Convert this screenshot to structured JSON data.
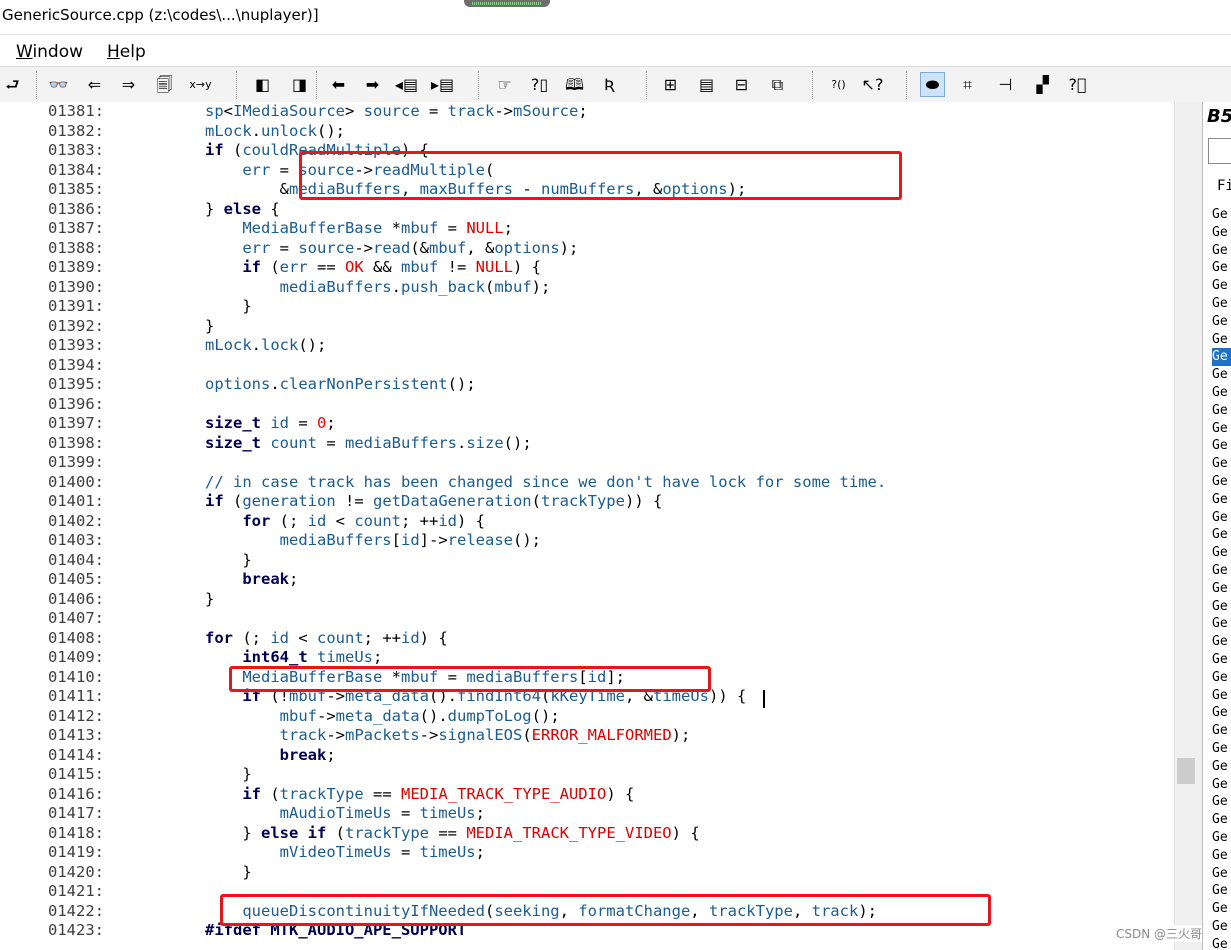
{
  "window": {
    "title": "GenericSource.cpp (z:\\codes\\...\\nuplayer)]"
  },
  "menu": [
    {
      "prefix": "",
      "underline": "W",
      "rest": "indow"
    },
    {
      "prefix": "",
      "underline": "H",
      "rest": "elp"
    }
  ],
  "toolbar": {
    "buttons": [
      {
        "icon": "lookup-icon",
        "glyph": "⮐"
      },
      {
        "icon": "binoculars-icon",
        "glyph": "👓"
      },
      {
        "icon": "search-back-icon",
        "glyph": "⇐"
      },
      {
        "icon": "search-forward-icon",
        "glyph": "⇒"
      },
      {
        "icon": "search-files-icon",
        "glyph": "🗐"
      },
      {
        "icon": "replace-icon",
        "glyph": "x→y"
      },
      {
        "icon": "bookmark-prev-icon",
        "glyph": "◧"
      },
      {
        "icon": "bookmark-next-icon",
        "glyph": "◨"
      },
      {
        "icon": "arrow-left-icon",
        "glyph": "⬅"
      },
      {
        "icon": "arrow-right-icon",
        "glyph": "➡"
      },
      {
        "icon": "jump-back-icon",
        "glyph": "◂▤"
      },
      {
        "icon": "jump-forward-icon",
        "glyph": "▸▤"
      },
      {
        "icon": "hand-icon",
        "glyph": "☞"
      },
      {
        "icon": "info-icon",
        "glyph": "?▯"
      },
      {
        "icon": "book-icon",
        "glyph": "🕮"
      },
      {
        "icon": "symbol-icon",
        "glyph": "Ʀ"
      },
      {
        "icon": "window-grid-icon",
        "glyph": "⊞"
      },
      {
        "icon": "window-list-icon",
        "glyph": "▤"
      },
      {
        "icon": "window-split-icon",
        "glyph": "⊟"
      },
      {
        "icon": "window-cascade-icon",
        "glyph": "⧉"
      },
      {
        "icon": "context-help-icon",
        "glyph": "?()"
      },
      {
        "icon": "pointer-help-icon",
        "glyph": "↖?"
      },
      {
        "icon": "toggle-view-icon",
        "glyph": "⬬"
      },
      {
        "icon": "relation-icon",
        "glyph": "⌗"
      },
      {
        "icon": "tree-icon",
        "glyph": "⊣"
      },
      {
        "icon": "layout-icon",
        "glyph": "▞"
      },
      {
        "icon": "help-box-icon",
        "glyph": "?⃞"
      }
    ]
  },
  "editor": {
    "lines": [
      {
        "n": "01381:",
        "code": "sp<IMediaSource> source = track->mSource;"
      },
      {
        "n": "01382:",
        "code": "mLock.unlock();"
      },
      {
        "n": "01383:",
        "code": "if (couldReadMultiple) {"
      },
      {
        "n": "01384:",
        "code": "    err = source->readMultiple("
      },
      {
        "n": "01385:",
        "code": "        &mediaBuffers, maxBuffers - numBuffers, &options);"
      },
      {
        "n": "01386:",
        "code": "} else {"
      },
      {
        "n": "01387:",
        "code": "    MediaBufferBase *mbuf = NULL;"
      },
      {
        "n": "01388:",
        "code": "    err = source->read(&mbuf, &options);"
      },
      {
        "n": "01389:",
        "code": "    if (err == OK && mbuf != NULL) {"
      },
      {
        "n": "01390:",
        "code": "        mediaBuffers.push_back(mbuf);"
      },
      {
        "n": "01391:",
        "code": "    }"
      },
      {
        "n": "01392:",
        "code": "}"
      },
      {
        "n": "01393:",
        "code": "mLock.lock();"
      },
      {
        "n": "01394:",
        "code": ""
      },
      {
        "n": "01395:",
        "code": "options.clearNonPersistent();"
      },
      {
        "n": "01396:",
        "code": ""
      },
      {
        "n": "01397:",
        "code": "size_t id = 0;"
      },
      {
        "n": "01398:",
        "code": "size_t count = mediaBuffers.size();"
      },
      {
        "n": "01399:",
        "code": ""
      },
      {
        "n": "01400:",
        "code": "// in case track has been changed since we don't have lock for some time."
      },
      {
        "n": "01401:",
        "code": "if (generation != getDataGeneration(trackType)) {"
      },
      {
        "n": "01402:",
        "code": "    for (; id < count; ++id) {"
      },
      {
        "n": "01403:",
        "code": "        mediaBuffers[id]->release();"
      },
      {
        "n": "01404:",
        "code": "    }"
      },
      {
        "n": "01405:",
        "code": "    break;"
      },
      {
        "n": "01406:",
        "code": "}"
      },
      {
        "n": "01407:",
        "code": ""
      },
      {
        "n": "01408:",
        "code": "for (; id < count; ++id) {"
      },
      {
        "n": "01409:",
        "code": "    int64_t timeUs;"
      },
      {
        "n": "01410:",
        "code": "    MediaBufferBase *mbuf = mediaBuffers[id];"
      },
      {
        "n": "01411:",
        "code": "    if (!mbuf->meta_data().findInt64(kKeyTime, &timeUs)) {"
      },
      {
        "n": "01412:",
        "code": "        mbuf->meta_data().dumpToLog();"
      },
      {
        "n": "01413:",
        "code": "        track->mPackets->signalEOS(ERROR_MALFORMED);"
      },
      {
        "n": "01414:",
        "code": "        break;"
      },
      {
        "n": "01415:",
        "code": "    }"
      },
      {
        "n": "01416:",
        "code": "    if (trackType == MEDIA_TRACK_TYPE_AUDIO) {"
      },
      {
        "n": "01417:",
        "code": "        mAudioTimeUs = timeUs;"
      },
      {
        "n": "01418:",
        "code": "    } else if (trackType == MEDIA_TRACK_TYPE_VIDEO) {"
      },
      {
        "n": "01419:",
        "code": "        mVideoTimeUs = timeUs;"
      },
      {
        "n": "01420:",
        "code": "    }"
      },
      {
        "n": "01421:",
        "code": ""
      },
      {
        "n": "01422:",
        "code": "    queueDiscontinuityIfNeeded(seeking, formatChange, trackType, track);"
      },
      {
        "n": "01423:",
        "code": "#ifdef MTK_AUDIO_APE_SUPPORT"
      }
    ],
    "highlight_color": "#e8161b",
    "keywords": [
      "if",
      "else",
      "for",
      "break",
      "size_t",
      "int64_t"
    ],
    "constants": [
      "NULL",
      "OK",
      "ERROR_MALFORMED",
      "MEDIA_TRACK_TYPE_AUDIO",
      "MEDIA_TRACK_TYPE_VIDEO"
    ]
  },
  "side_panel": {
    "title": "B5",
    "header": "Fi",
    "items": [
      "Ge",
      "Ge",
      "Ge",
      "Ge",
      "Ge",
      "Ge",
      "Ge",
      "Ge",
      "Ge",
      "Ge",
      "Ge",
      "Ge",
      "Ge",
      "Ge",
      "Ge",
      "Ge",
      "Ge",
      "Ge",
      "Ge",
      "Ge",
      "Ge",
      "Ge",
      "Ge",
      "Ge",
      "Ge",
      "Ge",
      "Ge",
      "Ge",
      "Ge",
      "Ge",
      "Ge",
      "Ge",
      "Ge",
      "Ge",
      "Ge",
      "Ge",
      "Ge",
      "Ge",
      "Ge",
      "Ge",
      "Ge",
      "Ge"
    ],
    "selected_index": 8
  },
  "watermark": "CSDN @三火哥"
}
